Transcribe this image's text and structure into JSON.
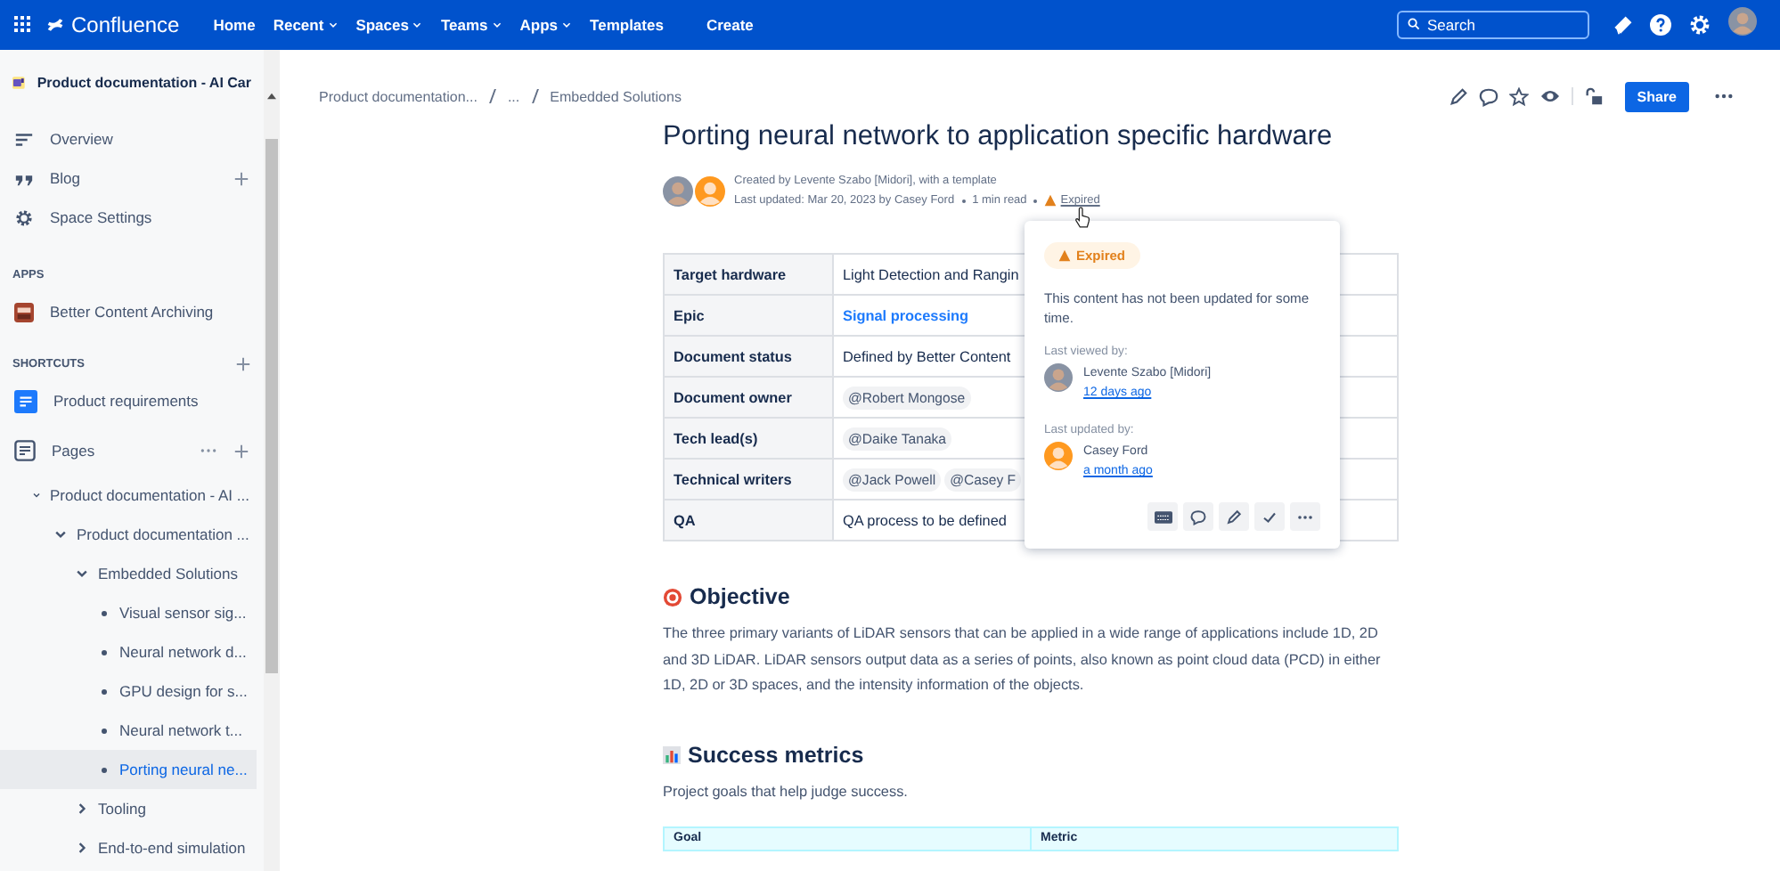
{
  "topbar": {
    "product": "Confluence",
    "nav": [
      {
        "label": "Home",
        "dropdown": false
      },
      {
        "label": "Recent",
        "dropdown": true
      },
      {
        "label": "Spaces",
        "dropdown": true
      },
      {
        "label": "Teams",
        "dropdown": true
      },
      {
        "label": "Apps",
        "dropdown": true
      },
      {
        "label": "Templates",
        "dropdown": false
      }
    ],
    "create": "Create",
    "search": {
      "placeholder": "Search"
    }
  },
  "sidebar": {
    "space": "Product documentation - AI Car",
    "items": [
      {
        "label": "Overview",
        "add": false
      },
      {
        "label": "Blog",
        "add": true
      },
      {
        "label": "Space Settings",
        "add": false
      }
    ],
    "apps_heading": "APPS",
    "apps": [
      "Better Content Archiving"
    ],
    "shortcuts_heading": "SHORTCUTS",
    "shortcuts": [
      "Product requirements"
    ],
    "pages_label": "Pages",
    "tree": [
      {
        "label": "Product documentation - AI ...",
        "expanded": true,
        "selected": false,
        "children": [
          {
            "label": "Product documentation ...",
            "expanded": true,
            "selected": false,
            "children": [
              {
                "label": "Embedded Solutions",
                "expanded": true,
                "selected": false,
                "children": [
                  {
                    "label": "Visual sensor sig...",
                    "selected": false
                  },
                  {
                    "label": "Neural network d...",
                    "selected": false
                  },
                  {
                    "label": "GPU design for s...",
                    "selected": false
                  },
                  {
                    "label": "Neural network t...",
                    "selected": false
                  },
                  {
                    "label": "Porting neural ne...",
                    "selected": true
                  }
                ]
              },
              {
                "label": "Tooling",
                "expanded": false,
                "selected": false
              },
              {
                "label": "End-to-end simulation",
                "expanded": false,
                "selected": false
              }
            ]
          }
        ]
      }
    ]
  },
  "breadcrumbs": [
    "Product documentation...",
    "...",
    "Embedded Solutions"
  ],
  "share": "Share",
  "page": {
    "title": "Porting neural network to application specific hardware",
    "created": "Created by Levente Szabo [Midori], with a template",
    "updated": "Last updated: Mar 20, 2023 by Casey Ford",
    "read": "1 min read",
    "status": "Expired",
    "table": [
      {
        "label": "Target hardware",
        "kind": "text",
        "value": "Light Detection and Rangin"
      },
      {
        "label": "Epic",
        "kind": "link",
        "value": "Signal processing"
      },
      {
        "label": "Document status",
        "kind": "text",
        "value": "Defined by Better Content"
      },
      {
        "label": "Document owner",
        "kind": "mentions",
        "mentions": [
          "@Robert Mongose"
        ]
      },
      {
        "label": "Tech lead(s)",
        "kind": "mentions",
        "mentions": [
          "@Daike Tanaka"
        ]
      },
      {
        "label": "Technical writers",
        "kind": "mentions",
        "mentions": [
          "@Jack Powell",
          "@Casey F"
        ]
      },
      {
        "label": "QA",
        "kind": "text",
        "value": "QA process to be defined"
      }
    ],
    "sections": [
      {
        "heading": "Objective",
        "text": "The three primary variants of LiDAR sensors that can be applied in a wide range of applications include 1D, 2D and 3D LiDAR. LiDAR sensors output data as a series of points, also known as point cloud data (PCD) in either 1D, 2D or 3D spaces, and the intensity information of the objects."
      },
      {
        "heading": "Success metrics",
        "text": "Project goals that help judge success."
      }
    ],
    "metrics_columns": [
      "Goal",
      "Metric"
    ]
  },
  "popover": {
    "badge": "Expired",
    "message": "This content has not been updated for some time.",
    "people": [
      {
        "label": "Last viewed by:",
        "name": "Levente Szabo [Midori]",
        "time": "12 days ago"
      },
      {
        "label": "Last updated by:",
        "name": "Casey Ford",
        "time": "a month ago"
      }
    ]
  }
}
